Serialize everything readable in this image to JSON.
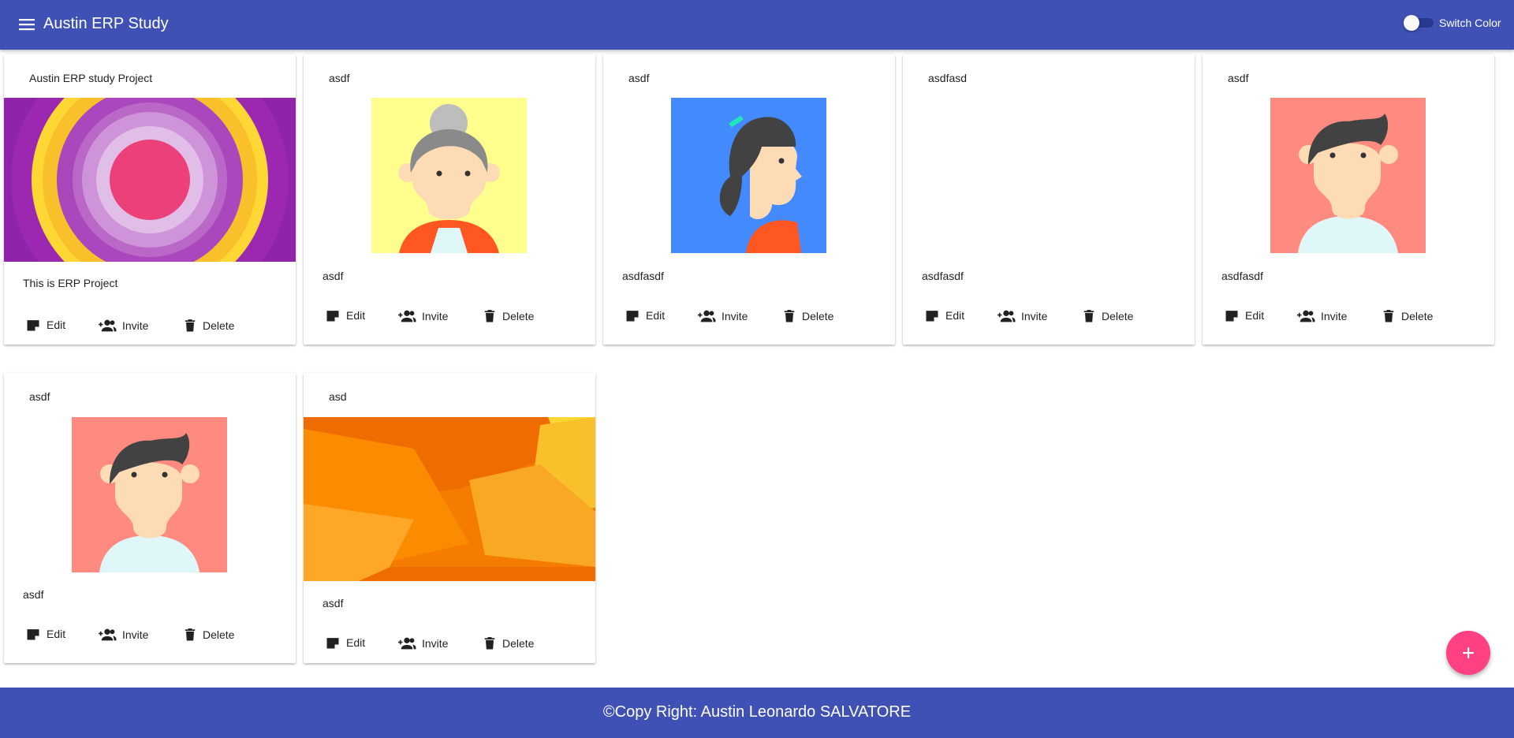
{
  "appbar": {
    "title": "Austin ERP Study",
    "switch_label": "Switch Color",
    "color": "#3f51b5"
  },
  "actions": {
    "edit": "Edit",
    "invite": "Invite",
    "delete": "Delete"
  },
  "cards": [
    {
      "title": "Austin ERP study Project",
      "description": "This is ERP Project",
      "image": "circles-abstract"
    },
    {
      "title": "asdf",
      "description": "asdf",
      "image": "avatar-grandma"
    },
    {
      "title": "asdf",
      "description": "asdfasdf",
      "image": "avatar-woman-ponytail"
    },
    {
      "title": "asdfasd",
      "description": "asdfasdf",
      "image": ""
    },
    {
      "title": "asdf",
      "description": "asdfasdf",
      "image": "avatar-boy"
    },
    {
      "title": "asdf",
      "description": "asdf",
      "image": "avatar-boy"
    },
    {
      "title": "asd",
      "description": "asdf",
      "image": "orange-shards-abstract"
    }
  ],
  "footer": {
    "text": "©Copy Right: Austin Leonardo SALVATORE"
  },
  "fab": {
    "icon": "plus-icon",
    "color": "#ff4081"
  }
}
